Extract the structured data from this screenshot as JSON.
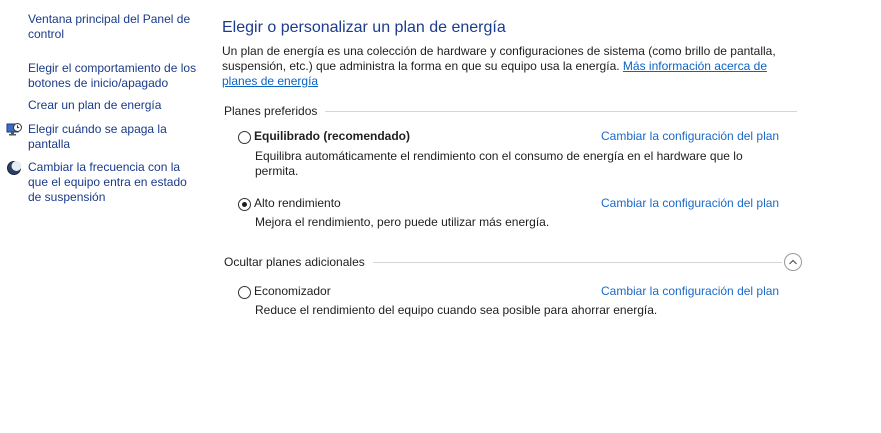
{
  "sidebar": {
    "items": [
      {
        "label": "Ventana principal del Panel de control",
        "icon": ""
      },
      {
        "label": "Elegir el comportamiento de los botones de inicio/apagado",
        "icon": ""
      },
      {
        "label": "Crear un plan de energía",
        "icon": ""
      },
      {
        "label": "Elegir cuándo se apaga la pantalla",
        "icon": "monitor-clock-icon"
      },
      {
        "label": "Cambiar la frecuencia con la que el equipo entra en estado de suspensión",
        "icon": "moon-icon"
      }
    ]
  },
  "main": {
    "title": "Elegir o personalizar un plan de energía",
    "description": "Un plan de energía es una colección de hardware y configuraciones de sistema (como brillo de pantalla, suspensión, etc.) que administra la forma en que su equipo usa la energía.",
    "description_link": "Más información acerca de planes de energía",
    "preferred_group_label": "Planes preferidos",
    "additional_group_label": "Ocultar planes adicionales",
    "plans": [
      {
        "name": "Equilibrado (recomendado)",
        "description": "Equilibra automáticamente el rendimiento con el consumo de energía en el hardware que lo permita.",
        "link": "Cambiar la configuración del plan",
        "selected": false
      },
      {
        "name": "Alto rendimiento",
        "description": "Mejora el rendimiento, pero puede utilizar más energía.",
        "link": "Cambiar la configuración del plan",
        "selected": true
      },
      {
        "name": "Economizador",
        "description": "Reduce el rendimiento del equipo cuando sea posible para ahorrar energía.",
        "link": "Cambiar la configuración del plan",
        "selected": false
      }
    ]
  },
  "colors": {
    "link": "#1b6ac9",
    "title": "#1b3b8f",
    "sidebar_link": "#1a3a8a"
  }
}
